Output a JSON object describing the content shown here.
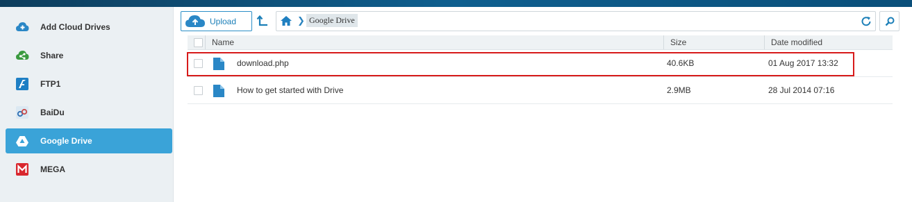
{
  "sidebar": {
    "items": [
      {
        "label": "Add Cloud Drives",
        "icon": "add-cloud-icon",
        "active": false
      },
      {
        "label": "Share",
        "icon": "share-icon",
        "active": false
      },
      {
        "label": "FTP1",
        "icon": "ftp-icon",
        "active": false
      },
      {
        "label": "BaiDu",
        "icon": "baidu-icon",
        "active": false
      },
      {
        "label": "Google Drive",
        "icon": "google-drive-icon",
        "active": true
      },
      {
        "label": "MEGA",
        "icon": "mega-icon",
        "active": false
      }
    ]
  },
  "toolbar": {
    "upload_label": "Upload",
    "breadcrumb": [
      "Google Drive"
    ]
  },
  "table": {
    "columns": {
      "name": "Name",
      "size": "Size",
      "date": "Date modified"
    },
    "rows": [
      {
        "name": "download.php",
        "size": "40.6KB",
        "date": "01 Aug 2017 13:32",
        "highlighted": true
      },
      {
        "name": "How to get started with Drive",
        "size": "2.9MB",
        "date": "28 Jul 2014 07:16",
        "highlighted": false
      }
    ]
  },
  "colors": {
    "accent": "#3aa3d8",
    "highlight_border": "#d71a1a",
    "topbar": "#0f5f8f"
  }
}
